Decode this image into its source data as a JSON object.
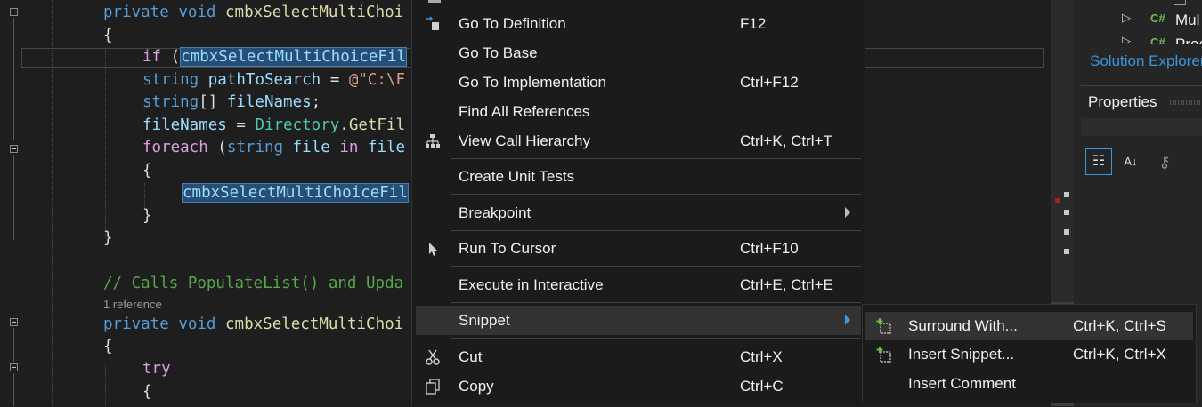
{
  "editor": {
    "lines": [
      {
        "parts": [
          {
            "t": "private",
            "c": "kw"
          },
          {
            "t": " "
          },
          {
            "t": "void",
            "c": "kw"
          },
          {
            "t": " "
          },
          {
            "t": "cmbxSelectMultiChoi",
            "c": "mt"
          }
        ]
      },
      {
        "parts": [
          {
            "t": "{"
          }
        ]
      },
      {
        "parts": [
          {
            "t": "if",
            "c": "kwc"
          },
          {
            "t": " ("
          },
          {
            "t": "cmbxSelectMultiChoiceFil",
            "c": "id sel"
          }
        ]
      },
      {
        "parts": [
          {
            "t": "string",
            "c": "kw"
          },
          {
            "t": " "
          },
          {
            "t": "pathToSearch",
            "c": "id"
          },
          {
            "t": " = "
          },
          {
            "t": "@\"C:\\F",
            "c": "st"
          }
        ]
      },
      {
        "parts": [
          {
            "t": "string",
            "c": "kw"
          },
          {
            "t": "[] "
          },
          {
            "t": "fileNames",
            "c": "id"
          },
          {
            "t": ";"
          }
        ]
      },
      {
        "parts": [
          {
            "t": "fileNames",
            "c": "id"
          },
          {
            "t": " = "
          },
          {
            "t": "Directory",
            "c": "ty"
          },
          {
            "t": "."
          },
          {
            "t": "GetFil",
            "c": "mt"
          }
        ]
      },
      {
        "parts": [
          {
            "t": "foreach",
            "c": "kwc"
          },
          {
            "t": " ("
          },
          {
            "t": "string",
            "c": "kw"
          },
          {
            "t": " "
          },
          {
            "t": "file",
            "c": "id"
          },
          {
            "t": " "
          },
          {
            "t": "in",
            "c": "kwc"
          },
          {
            "t": " "
          },
          {
            "t": "file",
            "c": "id"
          }
        ]
      },
      {
        "parts": [
          {
            "t": "{"
          }
        ]
      },
      {
        "parts": [
          {
            "t": "cmbxSelectMultiChoiceFil",
            "c": "id sel"
          }
        ]
      },
      {
        "parts": [
          {
            "t": "}"
          }
        ]
      },
      {
        "parts": [
          {
            "t": "}"
          }
        ]
      },
      {
        "parts": [
          {
            "t": ""
          }
        ]
      },
      {
        "parts": [
          {
            "t": "// Calls PopulateList() and Upda",
            "c": "cm"
          }
        ]
      },
      {
        "parts": [
          {
            "t": "private",
            "c": "kw"
          },
          {
            "t": " "
          },
          {
            "t": "void",
            "c": "kw"
          },
          {
            "t": " "
          },
          {
            "t": "cmbxSelectMultiChoi",
            "c": "mt"
          }
        ]
      },
      {
        "parts": [
          {
            "t": "{"
          }
        ]
      },
      {
        "parts": [
          {
            "t": "try",
            "c": "kwc"
          }
        ]
      },
      {
        "parts": [
          {
            "t": "{"
          }
        ]
      }
    ],
    "reference_hint": "1 reference"
  },
  "solution_panel": {
    "tree_item_1": "Mul",
    "tree_item_2": "Proc",
    "cs_badge": "C#",
    "tab_label": "Solution Explorer",
    "properties_title": "Properties"
  },
  "context_menu": {
    "items": [
      {
        "label": "Go To Definition",
        "shortcut": "F12",
        "icon": "goto-definition-icon"
      },
      {
        "label": "Go To Base",
        "shortcut": ""
      },
      {
        "label": "Go To Implementation",
        "shortcut": "Ctrl+F12"
      },
      {
        "label": "Find All References",
        "shortcut": ""
      },
      {
        "label": "View Call Hierarchy",
        "shortcut": "Ctrl+K, Ctrl+T",
        "icon": "call-hierarchy-icon"
      },
      {
        "label": "Create Unit Tests",
        "shortcut": ""
      },
      {
        "label": "Breakpoint",
        "shortcut": "",
        "submenu": true
      },
      {
        "label": "Run To Cursor",
        "shortcut": "Ctrl+F10",
        "icon": "cursor-arrow-icon"
      },
      {
        "label": "Execute in Interactive",
        "shortcut": "Ctrl+E, Ctrl+E"
      },
      {
        "label": "Snippet",
        "shortcut": "",
        "submenu": true,
        "highlighted": true
      },
      {
        "label": "Cut",
        "shortcut": "Ctrl+X",
        "icon": "scissors-icon"
      },
      {
        "label": "Copy",
        "shortcut": "Ctrl+C",
        "icon": "copy-icon"
      }
    ]
  },
  "snippet_submenu": {
    "items": [
      {
        "label": "Surround With...",
        "shortcut": "Ctrl+K, Ctrl+S",
        "icon": "snippet-add-icon",
        "highlighted": true
      },
      {
        "label": "Insert Snippet...",
        "shortcut": "Ctrl+K, Ctrl+X",
        "icon": "snippet-add-icon"
      },
      {
        "label": "Insert Comment",
        "shortcut": ""
      }
    ]
  },
  "colors": {
    "accent": "#3a96dd",
    "selection": "#264f78",
    "menu_bg": "#1b1b1c"
  }
}
